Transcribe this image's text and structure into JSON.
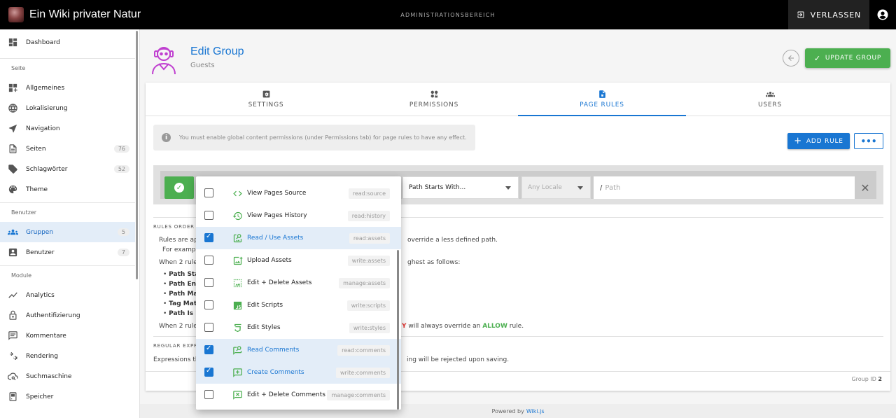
{
  "topbar": {
    "site_title": "Ein Wiki privater Natur",
    "admin_label": "ADMINISTRATIONSBEREICH",
    "exit_label": "VERLASSEN"
  },
  "sidebar": {
    "dashboard": "Dashboard",
    "section_site": "Seite",
    "site_items": [
      {
        "label": "Allgemeines",
        "icon": "widgets-icon"
      },
      {
        "label": "Lokalisierung",
        "icon": "globe-icon"
      },
      {
        "label": "Navigation",
        "icon": "navigation-icon"
      },
      {
        "label": "Seiten",
        "icon": "pages-icon",
        "count": "76"
      },
      {
        "label": "Schlagwörter",
        "icon": "tags-icon",
        "count": "52"
      },
      {
        "label": "Theme",
        "icon": "palette-icon"
      }
    ],
    "section_users": "Benutzer",
    "user_items": [
      {
        "label": "Gruppen",
        "icon": "groups-icon",
        "count": "5",
        "active": true
      },
      {
        "label": "Benutzer",
        "icon": "user-box-icon",
        "count": "7"
      }
    ],
    "section_modules": "Module",
    "module_items": [
      {
        "label": "Analytics",
        "icon": "chart-line-icon"
      },
      {
        "label": "Authentifizierung",
        "icon": "lock-icon"
      },
      {
        "label": "Kommentare",
        "icon": "comments-icon"
      },
      {
        "label": "Rendering",
        "icon": "cogs-icon"
      },
      {
        "label": "Suchmaschine",
        "icon": "search-cloud-icon"
      },
      {
        "label": "Speicher",
        "icon": "storage-icon"
      }
    ]
  },
  "header": {
    "title": "Edit Group",
    "subtitle": "Guests",
    "update_label": "UPDATE GROUP"
  },
  "tabs": [
    {
      "label": "SETTINGS",
      "icon": "settings-box-icon"
    },
    {
      "label": "PERMISSIONS",
      "icon": "permissions-icon"
    },
    {
      "label": "PAGE RULES",
      "icon": "file-lock-icon",
      "active": true
    },
    {
      "label": "USERS",
      "icon": "users-icon"
    }
  ],
  "page_rules": {
    "info": "You must enable global content permissions (under Permissions tab) for page rules to have any effect.",
    "add_rule_label": "ADD RULE",
    "more_label": "•••",
    "match_value": "Path Starts With...",
    "locale_value": "Any Locale",
    "path_prefix": "/",
    "path_placeholder": "Path",
    "rules_order_title": "RULES ORDER",
    "rules_text_1": "Rules are ap",
    "rules_text_1b": "override a less defined path.",
    "rules_text_2": "For examp",
    "rules_text_3": "When 2 rule",
    "rules_text_3b": "ghest as follows:",
    "list": [
      "Path Sta",
      "Path En",
      "Path Ma",
      "Tag Mat",
      "Path Is"
    ],
    "rules_text_4": "When 2 rule",
    "deny_word": "Y",
    "rules_text_4b": " will always override an ",
    "allow_word": "ALLOW",
    "rules_text_4c": " rule.",
    "regex_title": "REGULAR EXPRE",
    "regex_text_1": "Expressions th",
    "regex_text_2": "ing will be rejected upon saving.",
    "group_id_label": "Group ID",
    "group_id_value": "2"
  },
  "dropdown": [
    {
      "label": "View Pages Source",
      "code": "read:source",
      "icon": "code-icon",
      "checked": false
    },
    {
      "label": "View Pages History",
      "code": "read:history",
      "icon": "history-icon",
      "checked": false
    },
    {
      "label": "Read / Use Assets",
      "code": "read:assets",
      "icon": "image-search-icon",
      "checked": true
    },
    {
      "label": "Upload Assets",
      "code": "write:assets",
      "icon": "image-plus-icon",
      "checked": false
    },
    {
      "label": "Edit + Delete Assets",
      "code": "manage:assets",
      "icon": "image-edit-icon",
      "checked": false
    },
    {
      "label": "Edit Scripts",
      "code": "write:scripts",
      "icon": "js-icon",
      "checked": false
    },
    {
      "label": "Edit Styles",
      "code": "write:styles",
      "icon": "css-icon",
      "checked": false
    },
    {
      "label": "Read Comments",
      "code": "read:comments",
      "icon": "comment-search-icon",
      "checked": true
    },
    {
      "label": "Create Comments",
      "code": "write:comments",
      "icon": "comment-plus-icon",
      "checked": true
    },
    {
      "label": "Edit + Delete Comments",
      "code": "manage:comments",
      "icon": "comment-remove-icon",
      "checked": false
    }
  ],
  "footer": {
    "powered": "Powered by",
    "link": "Wiki.js"
  },
  "colors": {
    "accent": "#1976d2",
    "success": "#4caf50",
    "danger": "#e53935"
  }
}
